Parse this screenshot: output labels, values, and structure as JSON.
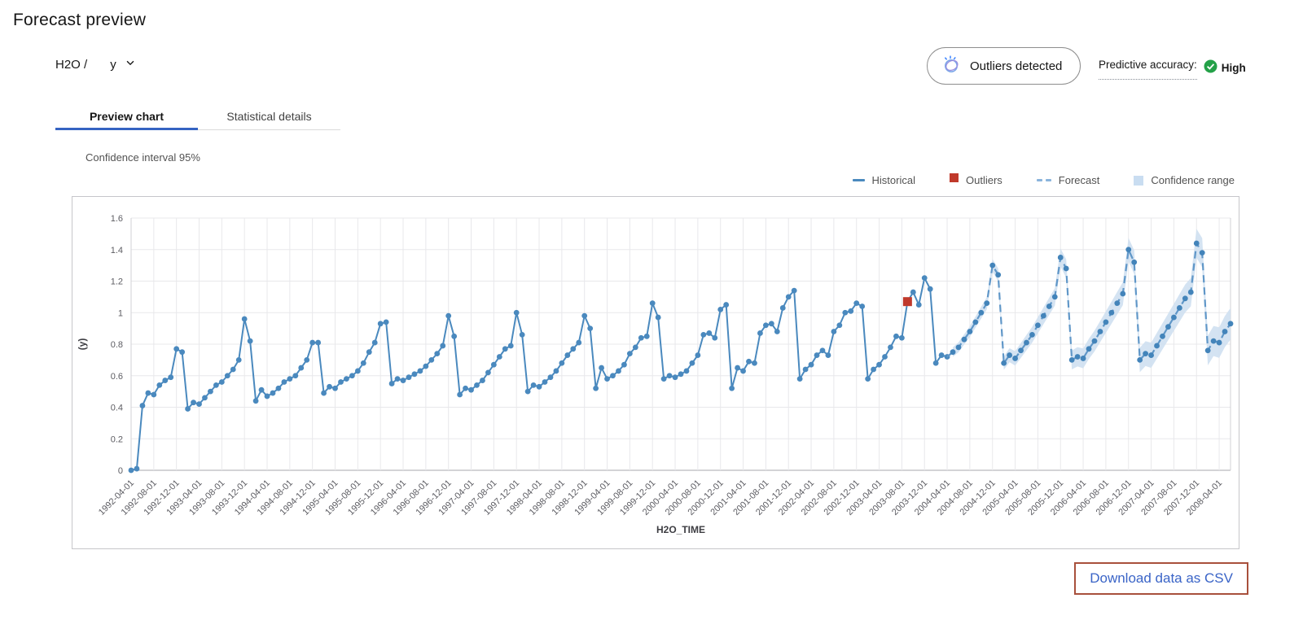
{
  "page": {
    "title": "Forecast preview"
  },
  "selector": {
    "prefix": "H2O /",
    "value": "y"
  },
  "status": {
    "outliers_pill": "Outliers detected",
    "accuracy_label": "Predictive accuracy:",
    "accuracy_value": "High"
  },
  "tabs": [
    {
      "label": "Preview chart",
      "active": true
    },
    {
      "label": "Statistical details",
      "active": false
    }
  ],
  "confidence_note": "Confidence interval 95%",
  "legend": [
    {
      "label": "Historical"
    },
    {
      "label": "Outliers"
    },
    {
      "label": "Forecast"
    },
    {
      "label": "Confidence range"
    }
  ],
  "download_button": "Download data as CSV",
  "colors": {
    "historical": "#4a89be",
    "forecast_line": "#6097c8",
    "forecast_marker": "#4384ba",
    "outlier": "#c0392b",
    "band": "#cfe0f1",
    "grid": "#e8e8eb",
    "axis": "#a7a7ad",
    "accent_blue": "#3563c2",
    "accuracy_green": "#24a148",
    "download_border": "#a8503c",
    "download_text": "#3a64c7"
  },
  "chart_data": {
    "type": "line",
    "title": "",
    "xlabel": "H2O_TIME",
    "ylabel": "(y)",
    "ylim": [
      0,
      1.6
    ],
    "y_ticks": [
      0,
      0.2,
      0.4,
      0.6,
      0.8,
      1,
      1.2,
      1.4,
      1.6
    ],
    "grid": true,
    "legend_position": "top-right",
    "start_date": "1992-04-01",
    "frequency": "monthly",
    "x_tick_step_months": 4,
    "x_tick_labels": [
      "1992-04-01",
      "1992-08-01",
      "1992-12-01",
      "1993-04-01",
      "1993-08-01",
      "1993-12-01",
      "1994-04-01",
      "1994-08-01",
      "1994-12-01",
      "1995-04-01",
      "1995-08-01",
      "1995-12-01",
      "1996-04-01",
      "1996-08-01",
      "1996-12-01",
      "1997-04-01",
      "1997-08-01",
      "1997-12-01",
      "1998-04-01",
      "1998-08-01",
      "1998-12-01",
      "1999-04-01",
      "1999-08-01",
      "1999-12-01",
      "2000-04-01",
      "2000-08-01",
      "2000-12-01",
      "2001-04-01",
      "2001-08-01",
      "2001-12-01",
      "2002-04-01",
      "2002-08-01",
      "2002-12-01",
      "2003-04-01",
      "2003-08-01",
      "2003-12-01",
      "2004-04-01",
      "2004-08-01",
      "2004-12-01",
      "2005-04-01",
      "2005-08-01",
      "2005-12-01",
      "2006-04-01",
      "2006-08-01",
      "2006-12-01",
      "2007-04-01",
      "2007-08-01",
      "2007-12-01",
      "2008-04-01"
    ],
    "series": [
      {
        "name": "Historical",
        "style": "solid",
        "start_index": 0,
        "start_date": "1992-04-01",
        "values": [
          0.0,
          0.01,
          0.41,
          0.49,
          0.48,
          0.54,
          0.57,
          0.59,
          0.77,
          0.75,
          0.39,
          0.43,
          0.42,
          0.46,
          0.5,
          0.54,
          0.56,
          0.6,
          0.64,
          0.7,
          0.96,
          0.82,
          0.44,
          0.51,
          0.47,
          0.49,
          0.52,
          0.56,
          0.58,
          0.6,
          0.65,
          0.7,
          0.81,
          0.81,
          0.49,
          0.53,
          0.52,
          0.56,
          0.58,
          0.6,
          0.63,
          0.68,
          0.75,
          0.81,
          0.93,
          0.94,
          0.55,
          0.58,
          0.57,
          0.59,
          0.61,
          0.63,
          0.66,
          0.7,
          0.74,
          0.79,
          0.98,
          0.85,
          0.48,
          0.52,
          0.51,
          0.54,
          0.57,
          0.62,
          0.67,
          0.72,
          0.77,
          0.79,
          1.0,
          0.86,
          0.5,
          0.54,
          0.53,
          0.56,
          0.59,
          0.63,
          0.68,
          0.73,
          0.77,
          0.81,
          0.98,
          0.9,
          0.52,
          0.65,
          0.58,
          0.6,
          0.63,
          0.67,
          0.74,
          0.78,
          0.84,
          0.85,
          1.06,
          0.97,
          0.58,
          0.6,
          0.59,
          0.61,
          0.63,
          0.68,
          0.73,
          0.86,
          0.87,
          0.84,
          1.02,
          1.05,
          0.52,
          0.65,
          0.63,
          0.69,
          0.68,
          0.87,
          0.92,
          0.93,
          0.88,
          1.03,
          1.1,
          1.14,
          0.58,
          0.64,
          0.67,
          0.73,
          0.76,
          0.73,
          0.88,
          0.92,
          1.0,
          1.01,
          1.06,
          1.04,
          0.58,
          0.64,
          0.67,
          0.72,
          0.78,
          0.85,
          0.84,
          1.07,
          1.13,
          1.05,
          1.22,
          1.15,
          0.68,
          0.73,
          0.72
        ]
      },
      {
        "name": "Forecast",
        "style": "dashed",
        "start_index": 145,
        "start_date": "2004-05-01",
        "values": [
          0.75,
          0.78,
          0.83,
          0.88,
          0.94,
          1.0,
          1.06,
          1.3,
          1.24,
          0.68,
          0.73,
          0.71,
          0.76,
          0.81,
          0.86,
          0.92,
          0.98,
          1.04,
          1.1,
          1.35,
          1.28,
          0.7,
          0.72,
          0.71,
          0.77,
          0.82,
          0.88,
          0.94,
          1.0,
          1.06,
          1.12,
          1.4,
          1.32,
          0.7,
          0.74,
          0.73,
          0.79,
          0.85,
          0.91,
          0.97,
          1.03,
          1.09,
          1.13,
          1.44,
          1.38,
          0.76,
          0.82,
          0.81,
          0.88,
          0.93
        ]
      }
    ],
    "outliers": [
      {
        "date": "2003-09-01",
        "index": 137,
        "value": 1.07
      }
    ],
    "confidence": {
      "start_index": 145,
      "delta_start": 0.03,
      "delta_end": 0.1,
      "interval": "95%"
    }
  }
}
